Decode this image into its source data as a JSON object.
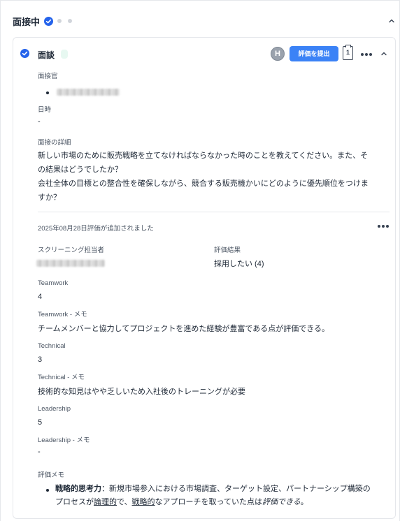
{
  "stage": {
    "title": "面接中",
    "status_icon": "check-circle-icon",
    "collapse_icon": "chevron-up-icon"
  },
  "card": {
    "title": "面談",
    "status_icon": "check-circle-icon",
    "avatar_initial": "H",
    "submit_label": "評価を提出",
    "clipboard_count": "1",
    "more_icon": "more-horizontal-icon",
    "collapse_icon": "chevron-up-icon"
  },
  "interview": {
    "interviewer_label": "面接官",
    "datetime_label": "日時",
    "datetime_value": "-",
    "details_label": "面接の詳細",
    "details_lines": [
      "新しい市場のために販売戦略を立てなければならなかった時のことを教えてください。また、そ",
      "の結果はどうでしたか？",
      "会社全体の目標との整合性を確保しながら、競合する販売機かいにどのように優先順位をつけま",
      "すか？"
    ]
  },
  "evaluation": {
    "added_text": "2025年08月28日評価が追加されました",
    "screener_label": "スクリーニング担当者",
    "result_label": "評価結果",
    "result_value": "採用したい (4)",
    "criteria": [
      {
        "label": "Teamwork",
        "score": "4",
        "memo_label": "Teamwork - メモ",
        "memo": "チームメンバーと協力してプロジェクトを進めた経験が豊富である点が評価できる。"
      },
      {
        "label": "Technical",
        "score": "3",
        "memo_label": "Technical - メモ",
        "memo": "技術的な知見はやや乏しいため入社後のトレーニングが必要"
      },
      {
        "label": "Leadership",
        "score": "5",
        "memo_label": "Leadership - メモ",
        "memo": "-"
      }
    ],
    "memo_label": "評価メモ",
    "memo_bold": "戦略的思考力",
    "memo_line1_rest": "：新規市場参入における市場調査、ターゲット設定、パートナーシップ構築の",
    "memo_line2_a": "プロセスが",
    "memo_line2_u1": "論理的",
    "memo_line2_b": "で、",
    "memo_line2_u2": "戦略的",
    "memo_line2_c": "なアプローチを取っていた点は",
    "memo_line2_i": "評価できる",
    "memo_line2_end": "。"
  },
  "colors": {
    "accent": "#3b82f6",
    "check": "#2563eb",
    "border": "#e5e7eb",
    "text": "#1f2937",
    "muted": "#4b5563"
  }
}
